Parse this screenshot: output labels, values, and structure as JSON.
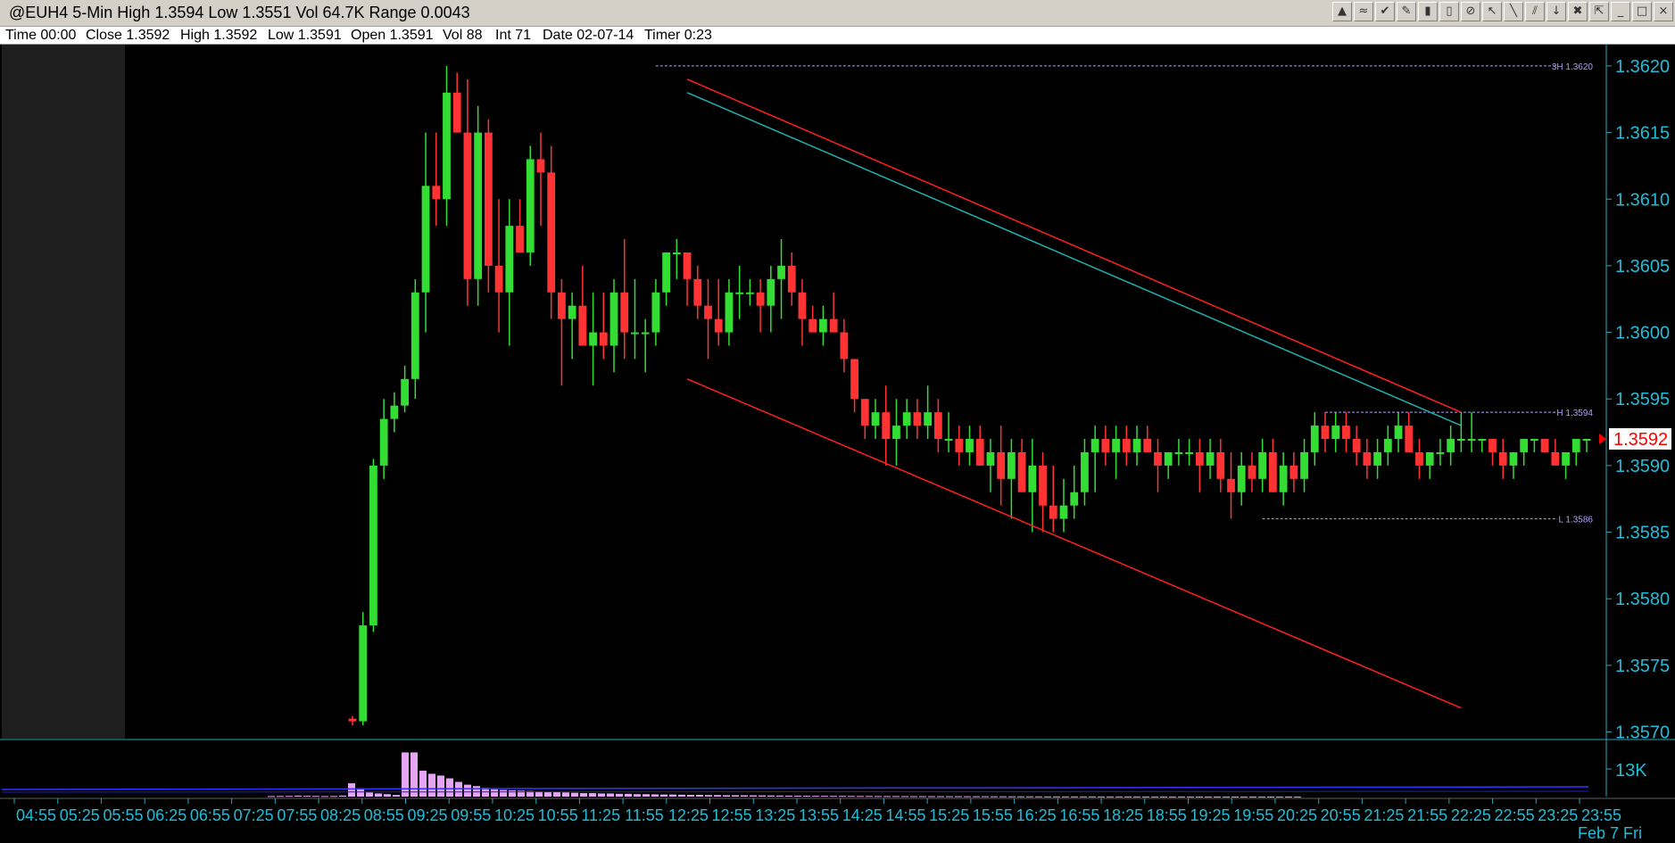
{
  "window": {
    "title": "@EUH4 5-Min High 1.3594 Low 1.3551 Vol 64.7K Range 0.0043"
  },
  "toolbar": {
    "buttons": [
      {
        "icon": "layers-icon",
        "glyph": "▲"
      },
      {
        "icon": "indicator-icon",
        "glyph": "≈"
      },
      {
        "icon": "strategy-icon",
        "glyph": "✔"
      },
      {
        "icon": "pencil-icon",
        "glyph": "✎"
      },
      {
        "icon": "chart-style-icon",
        "glyph": "▮"
      },
      {
        "icon": "candle-icon",
        "glyph": "▯"
      },
      {
        "icon": "no-entry-icon",
        "glyph": "⊘"
      },
      {
        "icon": "cursor-icon",
        "glyph": "↖"
      },
      {
        "icon": "line-tool-icon",
        "glyph": "╲"
      },
      {
        "icon": "parallel-lines-icon",
        "glyph": "⫽"
      },
      {
        "icon": "arrow-down-icon",
        "glyph": "↓"
      },
      {
        "icon": "trash-icon",
        "glyph": "✖"
      },
      {
        "icon": "pointer-icon",
        "glyph": "⇱"
      },
      {
        "icon": "minimize-icon",
        "glyph": "_"
      },
      {
        "icon": "maximize-icon",
        "glyph": "□"
      },
      {
        "icon": "close-icon",
        "glyph": "×"
      }
    ]
  },
  "info": {
    "time": "Time 00:00",
    "close": "Close 1.3592",
    "high": "High 1.3592",
    "low": "Low 1.3591",
    "open": "Open 1.3591",
    "vol": "Vol 88",
    "int": "Int 71",
    "date": "Date 02-07-14",
    "timer": "Timer 0:23"
  },
  "colors": {
    "background": "#000000",
    "session_shade": "#1e1e1e",
    "up": "#33dd33",
    "down": "#ff3333",
    "axis_text": "#22bcd8",
    "axis_line": "#2aa6b8",
    "channel": "#ff2020",
    "trendline": "#20b0b0",
    "level_line": "#b0a0ff",
    "volume": "#e6a4f4",
    "volume_avg": "#3333ff",
    "last_price_box": "#ffffff",
    "last_price_text": "#ff0000"
  },
  "chart_data": {
    "type": "candlestick",
    "title": "@EUH4 5-Min",
    "price_axis": {
      "ylim": [
        1.35695,
        1.3621
      ],
      "ticks": [
        "1.3620",
        "1.3615",
        "1.3610",
        "1.3605",
        "1.3600",
        "1.3595",
        "1.3590",
        "1.3585",
        "1.3580",
        "1.3575",
        "1.3570"
      ],
      "tick_values": [
        1.362,
        1.3615,
        1.361,
        1.3605,
        1.36,
        1.3595,
        1.359,
        1.3585,
        1.358,
        1.3575,
        1.357
      ]
    },
    "last_price_label": "1.3592",
    "last_price": 1.3592,
    "levels": [
      {
        "label": "3H 1.3620",
        "value": 1.362,
        "from_bar": 29
      },
      {
        "label": "H 1.3594",
        "value": 1.3594,
        "from_bar": 93
      },
      {
        "label": "L 1.3586",
        "value": 1.3586,
        "from_bar": 87
      }
    ],
    "channel_lines": [
      {
        "from": [
          32,
          1.3619
        ],
        "to": [
          106,
          1.3594
        ]
      },
      {
        "from": [
          32,
          1.35965
        ],
        "to": [
          106,
          1.35718
        ]
      }
    ],
    "trend_line": {
      "from": [
        32,
        1.3618
      ],
      "to": [
        106,
        1.3593
      ]
    },
    "volume_axis": {
      "label": "13K",
      "max": 15000
    },
    "time_axis_labels": [
      "04:55",
      "05:25",
      "05:55",
      "06:25",
      "06:55",
      "07:25",
      "07:55",
      "08:25",
      "08:55",
      "09:25",
      "09:55",
      "10:25",
      "10:55",
      "11:25",
      "11:55",
      "12:25",
      "12:55",
      "13:25",
      "13:55",
      "14:25",
      "14:55",
      "15:25",
      "15:55",
      "16:25",
      "16:55",
      "18:25",
      "18:55",
      "19:25",
      "19:55",
      "20:25",
      "20:55",
      "21:25",
      "21:55",
      "22:25",
      "22:55",
      "23:25",
      "23:55"
    ],
    "date_label": "Feb 7 Fri",
    "candles": [
      [
        1.3571,
        1.35712,
        1.35705,
        1.35708
      ],
      [
        1.35708,
        1.3579,
        1.35705,
        1.3578
      ],
      [
        1.3578,
        1.35905,
        1.35775,
        1.359
      ],
      [
        1.359,
        1.3595,
        1.3589,
        1.35935
      ],
      [
        1.35935,
        1.35955,
        1.35925,
        1.35945
      ],
      [
        1.35945,
        1.35975,
        1.3594,
        1.35965
      ],
      [
        1.35965,
        1.3604,
        1.3595,
        1.3603
      ],
      [
        1.3603,
        1.3615,
        1.36,
        1.3611
      ],
      [
        1.3611,
        1.3615,
        1.3608,
        1.361
      ],
      [
        1.361,
        1.362,
        1.3608,
        1.3618
      ],
      [
        1.3618,
        1.36195,
        1.3615,
        1.3615
      ],
      [
        1.3615,
        1.3619,
        1.3602,
        1.3604
      ],
      [
        1.3604,
        1.3617,
        1.3602,
        1.3615
      ],
      [
        1.3615,
        1.3616,
        1.3603,
        1.3605
      ],
      [
        1.3605,
        1.361,
        1.36,
        1.3603
      ],
      [
        1.3603,
        1.361,
        1.3599,
        1.3608
      ],
      [
        1.3608,
        1.361,
        1.3606,
        1.3606
      ],
      [
        1.3606,
        1.3614,
        1.3605,
        1.3613
      ],
      [
        1.3613,
        1.3615,
        1.3608,
        1.3612
      ],
      [
        1.3612,
        1.3614,
        1.3601,
        1.3603
      ],
      [
        1.3603,
        1.3604,
        1.3596,
        1.3601
      ],
      [
        1.3601,
        1.3603,
        1.3598,
        1.3602
      ],
      [
        1.3602,
        1.3605,
        1.3599,
        1.3599
      ],
      [
        1.3599,
        1.3603,
        1.3596,
        1.36
      ],
      [
        1.36,
        1.3603,
        1.3598,
        1.3599
      ],
      [
        1.3599,
        1.3604,
        1.3597,
        1.3603
      ],
      [
        1.3603,
        1.3607,
        1.3598,
        1.36
      ],
      [
        1.36,
        1.3604,
        1.3598,
        1.36
      ],
      [
        1.36,
        1.3601,
        1.3597,
        1.36
      ],
      [
        1.36,
        1.3604,
        1.3599,
        1.3603
      ],
      [
        1.3603,
        1.3606,
        1.3602,
        1.3606
      ],
      [
        1.3606,
        1.3607,
        1.3604,
        1.3606
      ],
      [
        1.3606,
        1.3606,
        1.3602,
        1.3604
      ],
      [
        1.3604,
        1.3605,
        1.3601,
        1.3602
      ],
      [
        1.3602,
        1.3604,
        1.3598,
        1.3601
      ],
      [
        1.3601,
        1.3604,
        1.3599,
        1.36
      ],
      [
        1.36,
        1.3604,
        1.3599,
        1.3603
      ],
      [
        1.3603,
        1.3605,
        1.3601,
        1.3603
      ],
      [
        1.3603,
        1.3604,
        1.3602,
        1.3603
      ],
      [
        1.3603,
        1.3604,
        1.36,
        1.3602
      ],
      [
        1.3602,
        1.3605,
        1.36,
        1.3604
      ],
      [
        1.3604,
        1.3607,
        1.3601,
        1.3605
      ],
      [
        1.3605,
        1.3606,
        1.3602,
        1.3603
      ],
      [
        1.3603,
        1.3604,
        1.3599,
        1.3601
      ],
      [
        1.3601,
        1.3602,
        1.36,
        1.36
      ],
      [
        1.36,
        1.3602,
        1.3599,
        1.3601
      ],
      [
        1.3601,
        1.3603,
        1.36,
        1.36
      ],
      [
        1.36,
        1.3601,
        1.3597,
        1.3598
      ],
      [
        1.3598,
        1.3598,
        1.3594,
        1.3595
      ],
      [
        1.3595,
        1.3595,
        1.3592,
        1.3593
      ],
      [
        1.3593,
        1.3595,
        1.3592,
        1.3594
      ],
      [
        1.3594,
        1.3596,
        1.359,
        1.3592
      ],
      [
        1.3592,
        1.3595,
        1.359,
        1.3593
      ],
      [
        1.3593,
        1.3595,
        1.3592,
        1.3594
      ],
      [
        1.3594,
        1.3595,
        1.3592,
        1.3593
      ],
      [
        1.3593,
        1.3596,
        1.3592,
        1.3594
      ],
      [
        1.3594,
        1.3595,
        1.3591,
        1.3592
      ],
      [
        1.3592,
        1.3594,
        1.3591,
        1.3592
      ],
      [
        1.3592,
        1.3593,
        1.359,
        1.3591
      ],
      [
        1.3591,
        1.3593,
        1.359,
        1.3592
      ],
      [
        1.3592,
        1.3593,
        1.359,
        1.359
      ],
      [
        1.359,
        1.3592,
        1.3588,
        1.3591
      ],
      [
        1.3591,
        1.3593,
        1.3587,
        1.3589
      ],
      [
        1.3589,
        1.3592,
        1.3586,
        1.3591
      ],
      [
        1.3591,
        1.3592,
        1.3588,
        1.3588
      ],
      [
        1.3588,
        1.3592,
        1.3585,
        1.359
      ],
      [
        1.359,
        1.3591,
        1.3585,
        1.3587
      ],
      [
        1.3587,
        1.359,
        1.3585,
        1.3586
      ],
      [
        1.3586,
        1.3589,
        1.3585,
        1.3587
      ],
      [
        1.3587,
        1.359,
        1.3586,
        1.3588
      ],
      [
        1.3588,
        1.3592,
        1.3587,
        1.3591
      ],
      [
        1.3591,
        1.3593,
        1.3588,
        1.3592
      ],
      [
        1.3592,
        1.3593,
        1.359,
        1.3591
      ],
      [
        1.3591,
        1.3593,
        1.3589,
        1.3592
      ],
      [
        1.3592,
        1.3593,
        1.359,
        1.3591
      ],
      [
        1.3591,
        1.3593,
        1.359,
        1.3592
      ],
      [
        1.3592,
        1.3593,
        1.3591,
        1.3591
      ],
      [
        1.3591,
        1.3592,
        1.3588,
        1.359
      ],
      [
        1.359,
        1.3591,
        1.3589,
        1.3591
      ],
      [
        1.3591,
        1.3592,
        1.359,
        1.3591
      ],
      [
        1.3591,
        1.3592,
        1.359,
        1.3591
      ],
      [
        1.3591,
        1.3592,
        1.3588,
        1.359
      ],
      [
        1.359,
        1.3592,
        1.3589,
        1.3591
      ],
      [
        1.3591,
        1.3592,
        1.3588,
        1.3589
      ],
      [
        1.3589,
        1.3591,
        1.3586,
        1.3588
      ],
      [
        1.3588,
        1.3591,
        1.3587,
        1.359
      ],
      [
        1.359,
        1.3591,
        1.3588,
        1.3589
      ],
      [
        1.3589,
        1.3592,
        1.3588,
        1.3591
      ],
      [
        1.3591,
        1.3592,
        1.3588,
        1.3588
      ],
      [
        1.3588,
        1.3591,
        1.3587,
        1.359
      ],
      [
        1.359,
        1.3591,
        1.3588,
        1.3589
      ],
      [
        1.3589,
        1.3592,
        1.3588,
        1.3591
      ],
      [
        1.3591,
        1.3594,
        1.359,
        1.3593
      ],
      [
        1.3593,
        1.3594,
        1.3591,
        1.3592
      ],
      [
        1.3592,
        1.3594,
        1.3591,
        1.3593
      ],
      [
        1.3593,
        1.3594,
        1.3591,
        1.3592
      ],
      [
        1.3592,
        1.3593,
        1.359,
        1.3591
      ],
      [
        1.3591,
        1.3592,
        1.3589,
        1.359
      ],
      [
        1.359,
        1.3592,
        1.3589,
        1.3591
      ],
      [
        1.3591,
        1.3593,
        1.359,
        1.3592
      ],
      [
        1.3592,
        1.3594,
        1.3591,
        1.3593
      ],
      [
        1.3593,
        1.3594,
        1.3591,
        1.3591
      ],
      [
        1.3591,
        1.3592,
        1.3589,
        1.359
      ],
      [
        1.359,
        1.3591,
        1.3589,
        1.3591
      ],
      [
        1.3591,
        1.3592,
        1.359,
        1.3591
      ],
      [
        1.3591,
        1.3593,
        1.359,
        1.3592
      ],
      [
        1.3592,
        1.3594,
        1.3591,
        1.3592
      ],
      [
        1.3592,
        1.3594,
        1.3591,
        1.3592
      ],
      [
        1.3592,
        1.3592,
        1.3591,
        1.3592
      ],
      [
        1.3592,
        1.3592,
        1.359,
        1.3591
      ],
      [
        1.3591,
        1.3592,
        1.3589,
        1.359
      ],
      [
        1.359,
        1.3591,
        1.3589,
        1.3591
      ],
      [
        1.3591,
        1.3592,
        1.359,
        1.3592
      ],
      [
        1.3592,
        1.3592,
        1.3591,
        1.3592
      ],
      [
        1.3592,
        1.3592,
        1.3591,
        1.3591
      ],
      [
        1.3591,
        1.3592,
        1.359,
        1.359
      ],
      [
        1.359,
        1.3591,
        1.3589,
        1.3591
      ],
      [
        1.3591,
        1.3592,
        1.359,
        1.3592
      ],
      [
        1.3592,
        1.3592,
        1.3591,
        1.3592
      ]
    ],
    "volume": [
      150,
      180,
      200,
      280,
      220,
      200,
      160,
      170,
      300,
      3800,
      2400,
      1200,
      900,
      700,
      480,
      12600,
      12600,
      7400,
      6500,
      6000,
      5200,
      4200,
      3400,
      3000,
      2500,
      2100,
      1900,
      1800,
      1700,
      1600,
      1500,
      1400,
      1300,
      1200,
      1100,
      1000,
      1000,
      900,
      900,
      800,
      800,
      700,
      700,
      650,
      600,
      600,
      550,
      500,
      500,
      450,
      450,
      400,
      400,
      380,
      360,
      340,
      320,
      300,
      280,
      260,
      240,
      220,
      220,
      210,
      200,
      190,
      180,
      170,
      160,
      150,
      150,
      140,
      130,
      130,
      120,
      120,
      110,
      110,
      100,
      100,
      95,
      90,
      85,
      80,
      75,
      70,
      65,
      60,
      55,
      55,
      50,
      50,
      45,
      45,
      40,
      40,
      35,
      35,
      30,
      30,
      30,
      25,
      25,
      25,
      20,
      20,
      20,
      20,
      20,
      20,
      20,
      20,
      20,
      20,
      20,
      20
    ]
  }
}
